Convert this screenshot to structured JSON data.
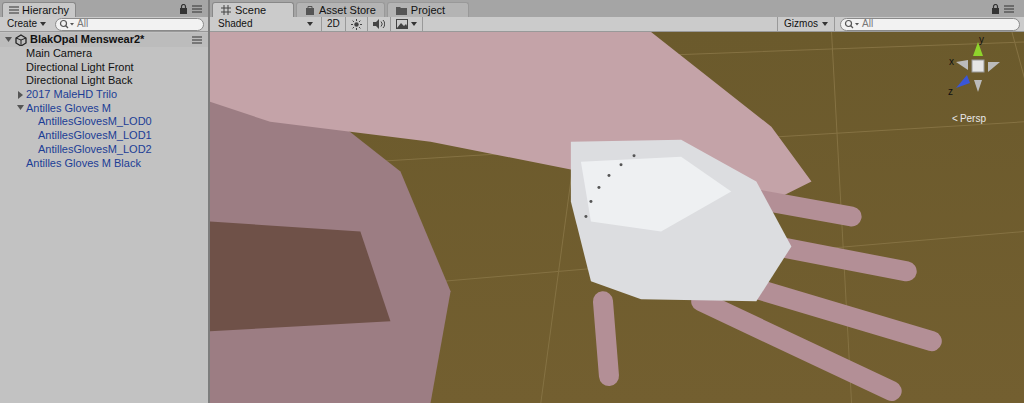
{
  "hierarchy": {
    "tab": "Hierarchy",
    "create_button": "Create",
    "search_placeholder": "All",
    "items": [
      {
        "label": "BlakOpal Menswear2*",
        "kind": "scene",
        "depth": 0,
        "has_children": true,
        "expanded": true,
        "prefab": false
      },
      {
        "label": "Main Camera",
        "kind": "object",
        "depth": 1,
        "has_children": false,
        "expanded": false,
        "prefab": false
      },
      {
        "label": "Directional Light Front",
        "kind": "object",
        "depth": 1,
        "has_children": false,
        "expanded": false,
        "prefab": false
      },
      {
        "label": "Directional Light Back",
        "kind": "object",
        "depth": 1,
        "has_children": false,
        "expanded": false,
        "prefab": false
      },
      {
        "label": "2017 MaleHD Trilo",
        "kind": "object",
        "depth": 1,
        "has_children": true,
        "expanded": false,
        "prefab": true
      },
      {
        "label": "Antilles Gloves M",
        "kind": "object",
        "depth": 1,
        "has_children": true,
        "expanded": true,
        "prefab": true
      },
      {
        "label": "AntillesGlovesM_LOD0",
        "kind": "object",
        "depth": 2,
        "has_children": false,
        "expanded": false,
        "prefab": true
      },
      {
        "label": "AntillesGlovesM_LOD1",
        "kind": "object",
        "depth": 2,
        "has_children": false,
        "expanded": false,
        "prefab": true
      },
      {
        "label": "AntillesGlovesM_LOD2",
        "kind": "object",
        "depth": 2,
        "has_children": false,
        "expanded": false,
        "prefab": true
      },
      {
        "label": "Antilles Gloves M Black",
        "kind": "object",
        "depth": 1,
        "has_children": false,
        "expanded": false,
        "prefab": true
      }
    ]
  },
  "scene_tabs": [
    {
      "label": "Scene",
      "selected": true
    },
    {
      "label": "Asset Store",
      "selected": false
    },
    {
      "label": "Project",
      "selected": false
    }
  ],
  "scene_toolbar": {
    "shading": "Shaded",
    "mode_2d": "2D",
    "gizmos": "Gizmos",
    "search_placeholder": "All"
  },
  "gizmo": {
    "axes": [
      "y",
      "x",
      "z"
    ],
    "projection": "Persp",
    "projection_icon": "<"
  }
}
